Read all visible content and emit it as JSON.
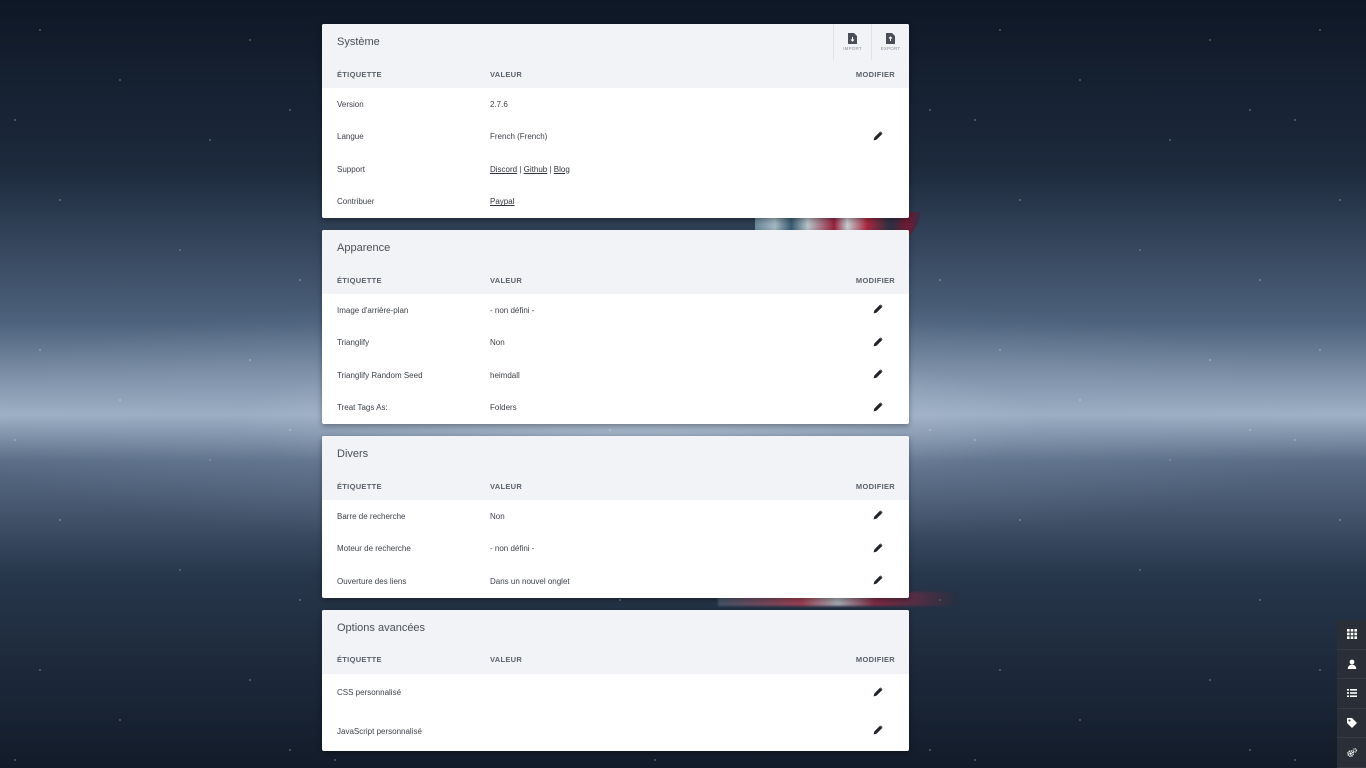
{
  "columns": {
    "label": "ÉTIQUETTE",
    "value": "VALEUR",
    "edit": "MODIFIER"
  },
  "toolbar": {
    "import_label": "IMPORT",
    "export_label": "EXPORT"
  },
  "system": {
    "title": "Système",
    "version": {
      "label": "Version",
      "value": "2.7.6"
    },
    "language": {
      "label": "Langue",
      "value": "French (French)"
    },
    "support": {
      "label": "Support",
      "discord": "Discord",
      "github": "Github",
      "blog": "Blog",
      "sep": "|"
    },
    "contribute": {
      "label": "Contribuer",
      "paypal": "Paypal"
    }
  },
  "appearance": {
    "title": "Apparence",
    "rows": [
      {
        "label": "Image d'arrière-plan",
        "value": "- non défini -"
      },
      {
        "label": "Trianglify",
        "value": "Non"
      },
      {
        "label": "Trianglify Random Seed",
        "value": "heimdall"
      },
      {
        "label": "Treat Tags As:",
        "value": "Folders"
      }
    ]
  },
  "misc": {
    "title": "Divers",
    "rows": [
      {
        "label": "Barre de recherche",
        "value": "Non"
      },
      {
        "label": "Moteur de recherche",
        "value": "- non défini -"
      },
      {
        "label": "Ouverture des liens",
        "value": "Dans un nouvel onglet"
      }
    ]
  },
  "advanced": {
    "title": "Options avancées",
    "rows": [
      {
        "label": "CSS personnalisé",
        "value": ""
      },
      {
        "label": "JavaScript personnalisé",
        "value": ""
      }
    ]
  },
  "sidebar": {
    "icons": [
      "grid-icon",
      "user-icon",
      "list-icon",
      "tag-icon",
      "cogs-icon"
    ]
  },
  "colors": {
    "card_header": "#f2f3f6",
    "sidebar": "#2a2f37",
    "text": "#3d4249"
  }
}
